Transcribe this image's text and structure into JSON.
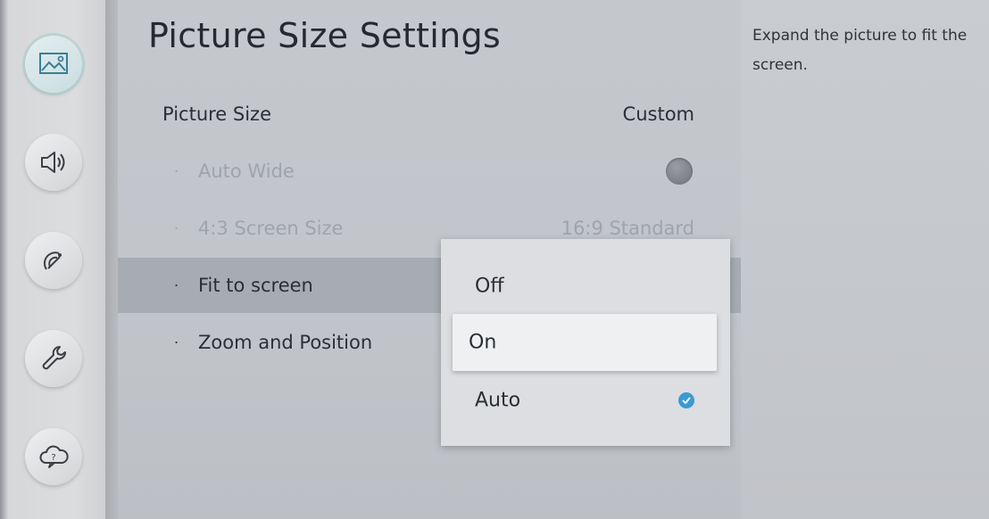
{
  "sidebar": {
    "items": [
      {
        "icon": "picture-icon",
        "active": true
      },
      {
        "icon": "sound-icon",
        "active": false
      },
      {
        "icon": "broadcasting-icon",
        "active": false
      },
      {
        "icon": "general-wrench-icon",
        "active": false
      },
      {
        "icon": "support-icon",
        "active": false
      }
    ]
  },
  "main": {
    "title": "Picture Size Settings",
    "rows": [
      {
        "label": "Picture Size",
        "value": "Custom",
        "disabled": false
      },
      {
        "label": "Auto Wide",
        "value": "",
        "disabled": true,
        "control": "toggle-off"
      },
      {
        "label": "4:3 Screen Size",
        "value": "16:9 Standard",
        "disabled": true
      },
      {
        "label": "Fit to screen",
        "value": "",
        "disabled": false,
        "focused": true
      },
      {
        "label": "Zoom and Position",
        "value": "",
        "disabled": false
      }
    ],
    "bullet": "·"
  },
  "dropdown": {
    "options": [
      {
        "label": "Off",
        "selected": false,
        "highlighted": false
      },
      {
        "label": "On",
        "selected": false,
        "highlighted": true
      },
      {
        "label": "Auto",
        "selected": true,
        "highlighted": false
      }
    ],
    "check_color": "#3c9ad2"
  },
  "help": {
    "text": "Expand the picture to fit the screen."
  },
  "colors": {
    "main_bg": "#c2c6cb",
    "focused_row": "#a7acb3",
    "accent": "#3c9ad2"
  }
}
